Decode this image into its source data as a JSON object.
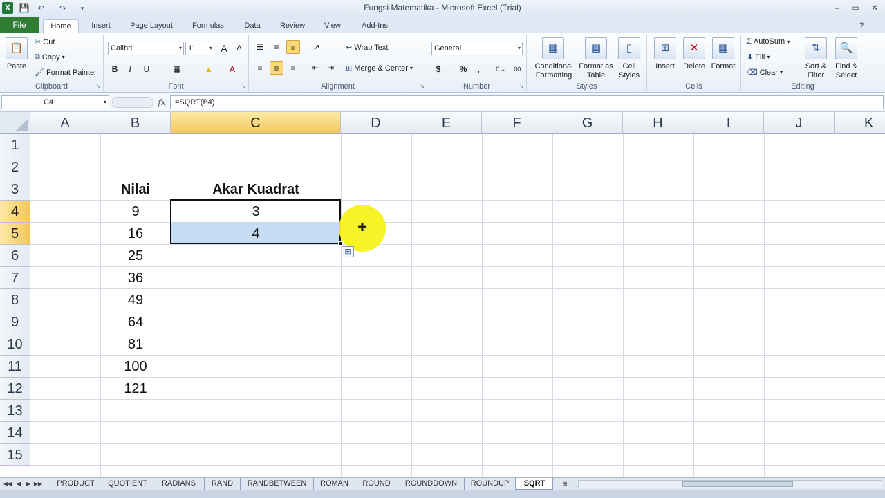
{
  "window": {
    "title": "Fungsi Matematika - Microsoft Excel (Trial)",
    "logo": "X",
    "controls": [
      "–",
      "▭",
      "✕"
    ]
  },
  "ribbon_tabs": [
    "File",
    "Home",
    "Insert",
    "Page Layout",
    "Formulas",
    "Data",
    "Review",
    "View",
    "Add-Ins"
  ],
  "active_tab": "Home",
  "clipboard": {
    "paste": "Paste",
    "cut": "Cut",
    "copy": "Copy",
    "format_painter": "Format Painter",
    "group": "Clipboard"
  },
  "font": {
    "name": "Calibri",
    "size": "11",
    "grow": "A",
    "shrink": "A",
    "bold": "B",
    "italic": "I",
    "underline": "U",
    "group": "Font"
  },
  "alignment": {
    "wrap_text": "Wrap Text",
    "merge_center": "Merge & Center",
    "group": "Alignment"
  },
  "number": {
    "format": "General",
    "currency": "$",
    "percent": "%",
    "comma": ",",
    "inc_decimal": ".0→",
    "dec_decimal": ".00",
    "group": "Number"
  },
  "styles": {
    "conditional": "Conditional Formatting",
    "format_table": "Format as Table",
    "cell_styles": "Cell Styles",
    "group": "Styles"
  },
  "cells": {
    "insert": "Insert",
    "delete": "Delete",
    "format": "Format",
    "group": "Cells"
  },
  "editing": {
    "autosum": "AutoSum",
    "fill": "Fill",
    "clear": "Clear",
    "sort_filter": "Sort & Filter",
    "find_select": "Find & Select",
    "group": "Editing"
  },
  "formula_bar": {
    "name_box": "C4",
    "fx": "fx",
    "formula": "=SQRT(B4)"
  },
  "columns": [
    "A",
    "B",
    "C",
    "D",
    "E",
    "F",
    "G",
    "H",
    "I",
    "J",
    "K"
  ],
  "selected_column": "C",
  "rows": [
    "1",
    "2",
    "3",
    "4",
    "5",
    "6",
    "7",
    "8",
    "9",
    "10",
    "11",
    "12",
    "13",
    "14",
    "15"
  ],
  "selected_rows": [
    "4",
    "5"
  ],
  "cells_data": {
    "B3": "Nilai",
    "C3": "Akar Kuadrat",
    "B4": "9",
    "C4": "3",
    "B5": "16",
    "C5": "4",
    "B6": "25",
    "B7": "36",
    "B8": "49",
    "B9": "64",
    "B10": "81",
    "B11": "100",
    "B12": "121"
  },
  "sheet_tabs": [
    "PRODUCT",
    "QUOTIENT",
    "RADIANS",
    "RAND",
    "RANDBETWEEN",
    "ROMAN",
    "ROUND",
    "ROUNDDOWN",
    "ROUNDUP",
    "SQRT"
  ],
  "active_sheet": "SQRT",
  "colors": {
    "file_tab": "#2e7d32",
    "selection_header": "#f6c75b",
    "selected_fill": "#c5dcf4",
    "cursor_highlight": "#f7f21a"
  }
}
